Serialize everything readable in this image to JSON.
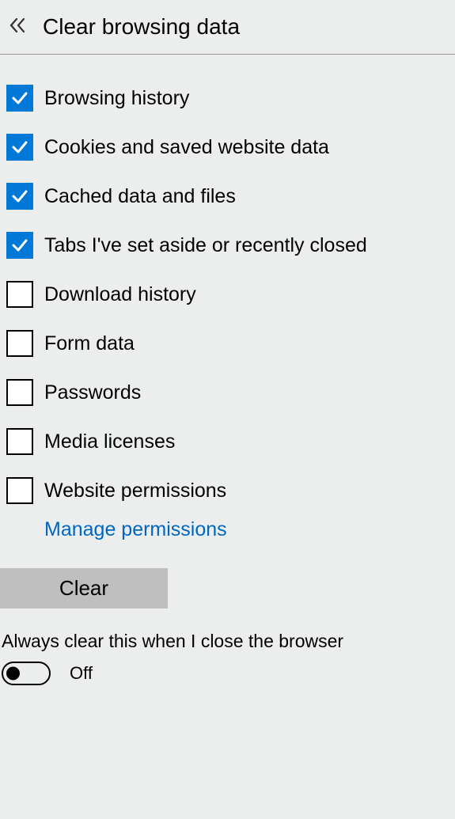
{
  "header": {
    "title": "Clear browsing data"
  },
  "items": [
    {
      "label": "Browsing history",
      "checked": true
    },
    {
      "label": "Cookies and saved website data",
      "checked": true
    },
    {
      "label": "Cached data and files",
      "checked": true
    },
    {
      "label": "Tabs I've set aside or recently closed",
      "checked": true
    },
    {
      "label": "Download history",
      "checked": false
    },
    {
      "label": "Form data",
      "checked": false
    },
    {
      "label": "Passwords",
      "checked": false
    },
    {
      "label": "Media licenses",
      "checked": false
    },
    {
      "label": "Website permissions",
      "checked": false
    }
  ],
  "link": {
    "manage_permissions": "Manage permissions"
  },
  "buttons": {
    "clear": "Clear"
  },
  "always_clear": {
    "label": "Always clear this when I close the browser",
    "state": "Off",
    "on": false
  }
}
